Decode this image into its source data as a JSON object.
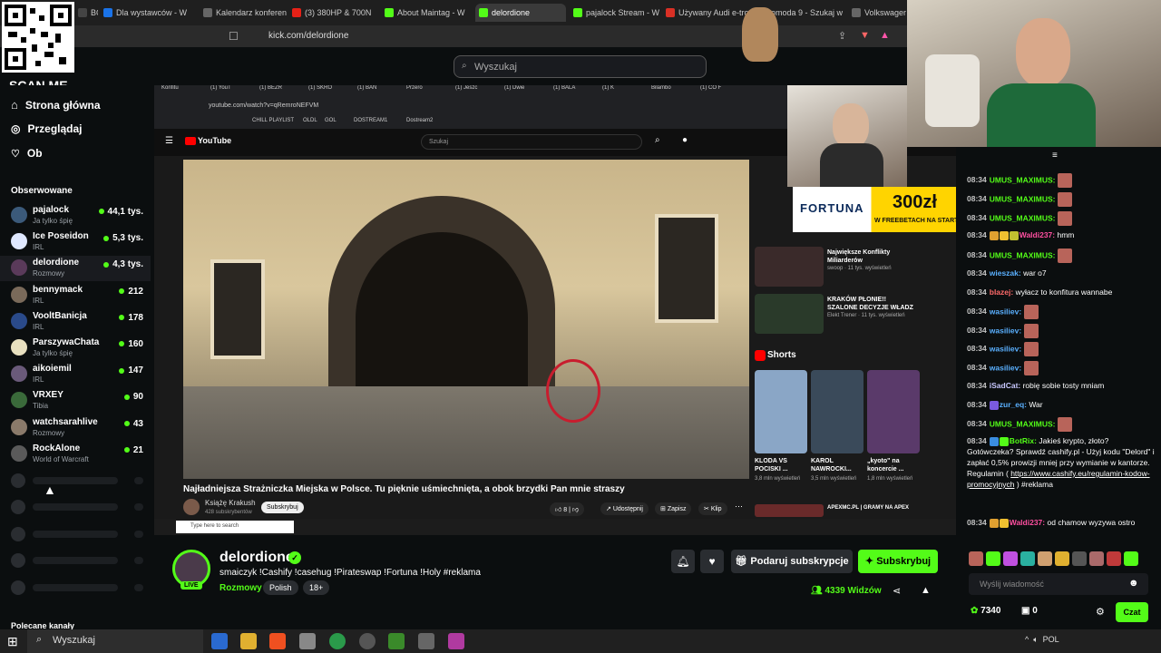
{
  "browser": {
    "tabs": [
      {
        "label": "BO"
      },
      {
        "label": "Dla wystawców - W"
      },
      {
        "label": "Kalendarz konferen"
      },
      {
        "label": "(3) 380HP & 700N"
      },
      {
        "label": "About Maintag - W"
      },
      {
        "label": "delordione"
      },
      {
        "label": "pajalock Stream - W"
      },
      {
        "label": "Używany Audi e-tro"
      },
      {
        "label": "omoda 9 - Szukaj w"
      },
      {
        "label": "Volkswager"
      }
    ],
    "url": "kick.com/delordione"
  },
  "overlay": {
    "scan_me": "SCAN ME",
    "qr_icon": "qr-code"
  },
  "header": {
    "search_placeholder": "Wyszukaj"
  },
  "sidebar": {
    "nav": [
      {
        "label": "Strona główna",
        "icon": "home-icon"
      },
      {
        "label": "Przeglądaj",
        "icon": "compass-icon"
      },
      {
        "label": "Ob",
        "icon": "heart-icon"
      }
    ],
    "following_title": "Obserwowane",
    "following": [
      {
        "name": "pajalock",
        "category": "Ja tylko śpię",
        "viewers": "44,1 tys.",
        "color": "#3b5a7a"
      },
      {
        "name": "Ice Poseidon",
        "category": "IRL",
        "viewers": "5,3 tys.",
        "color": "#dfe8ff"
      },
      {
        "name": "delordione",
        "category": "Rozmowy",
        "viewers": "4,3 tys.",
        "color": "#5a3a5a"
      },
      {
        "name": "bennymack",
        "category": "IRL",
        "viewers": "212",
        "color": "#7a6a5a"
      },
      {
        "name": "VooltBanicja",
        "category": "IRL",
        "viewers": "178",
        "color": "#2a4a8a"
      },
      {
        "name": "ParszywaChata",
        "category": "Ja tylko śpię",
        "viewers": "160",
        "color": "#e8e0c0"
      },
      {
        "name": "aikoiemil",
        "category": "IRL",
        "viewers": "147",
        "color": "#6a5a7a"
      },
      {
        "name": "VRXEY",
        "category": "Tibia",
        "viewers": "90",
        "color": "#3a6a3a"
      },
      {
        "name": "watchsarahlive",
        "category": "Rozmowy",
        "viewers": "43",
        "color": "#8a7a6a"
      },
      {
        "name": "RockAlone",
        "category": "World of Warcraft",
        "viewers": "21",
        "color": "#5a5a5a"
      }
    ],
    "recommended_title": "Polecane kanały"
  },
  "video": {
    "tabs": [
      "Konfitu",
      "(1) YouT",
      "(1) BEZR",
      "(1) SKRO",
      "(1) BAN",
      "Przero",
      "(1) Jeszc",
      "(1) Dwie",
      "(1) BALA",
      "(1) K",
      "Bilambo",
      "(1) CO F"
    ],
    "inner_url": "youtube.com/watch?v=qRemroNEFVM",
    "bookmarks": [
      "CHILL PLAYLIST",
      "OLDL",
      "GOL",
      "DOSTREAM1",
      "Dostream2"
    ],
    "yt_logo": "YouTube",
    "yt_search": "Szukaj",
    "title": "Najładniejsza Strażniczka Miejska w Polsce. Tu pięknie uśmiechnięta, a obok brzydki Pan mnie straszy",
    "channel": "Książę Krakush",
    "channel_subs": "428 subskrybentów",
    "subscribe": "Subskrybuj",
    "likes": "8",
    "share": "Udostępnij",
    "save": "Zapisz",
    "clip": "Klip",
    "sidebar_cards": [
      {
        "title": "Największe Konflikty Miliarderów",
        "meta": "swoop · 11 tys. wyświetleń",
        "color": "#3a2a2a"
      },
      {
        "title": "KRAKÓW PŁONIE!! SZALONE DECYZJE WŁADZ",
        "meta": "Elekt Trener · 11 tys. wyświetleń",
        "color": "#2a3a2a"
      }
    ],
    "shorts_label": "Shorts",
    "shorts": [
      {
        "title": "KLODA VS POCISKI ...",
        "views": "3,8 mln wyświetleń",
        "color": "#8aa6c6"
      },
      {
        "title": "KAROL NAWROCKI...",
        "views": "3,5 mln wyświetleń",
        "color": "#3a4a5a"
      },
      {
        "title": "„kyoto\" na koncercie ...",
        "views": "1,8 mln wyświetleń",
        "color": "#5a3a6a"
      }
    ],
    "extra_card": "APEXMC.PL | GRAMY NA APEX",
    "taskbar_search": "Type here to search",
    "fortuna_brand": "FORTUNA",
    "fortuna_promo": "300zł",
    "fortuna_tagline": "W FREEBETACH NA START"
  },
  "stream": {
    "name": "delordione",
    "live": "LIVE",
    "title": "smaiczyk !Cashify !casehug !Pirateswap !Fortuna !Holy #reklama",
    "category": "Rozmowy",
    "tags": [
      "Polish",
      "18+"
    ],
    "gift_subs": "Podaruj subskrypcje",
    "subscribe": "Subskrybuj",
    "viewers": "4339 Widzów"
  },
  "chat": {
    "messages": [
      {
        "time": "08:34",
        "user": "UMUS_MAXIMUS:",
        "color": "#53fc18",
        "text": "",
        "emote": true
      },
      {
        "time": "08:34",
        "user": "UMUS_MAXIMUS:",
        "color": "#53fc18",
        "text": "",
        "emote": true
      },
      {
        "time": "08:34",
        "user": "UMUS_MAXIMUS:",
        "color": "#53fc18",
        "text": "",
        "emote": true
      },
      {
        "time": "08:34",
        "user": "Waldi237:",
        "color": "#ff4fa0",
        "text": "hmm",
        "emote": false
      },
      {
        "time": "08:34",
        "user": "UMUS_MAXIMUS:",
        "color": "#53fc18",
        "text": "",
        "emote": true
      },
      {
        "time": "08:34",
        "user": "wieszak:",
        "color": "#5ab0ff",
        "text": "war o7",
        "emote": false
      },
      {
        "time": "08:34",
        "user": "blazej:",
        "color": "#ff6a6a",
        "text": "wyłacz to konfitura wannabe",
        "emote": false
      },
      {
        "time": "08:34",
        "user": "wasiliev:",
        "color": "#5ab0ff",
        "text": "",
        "emote": true
      },
      {
        "time": "08:34",
        "user": "wasiliev:",
        "color": "#5ab0ff",
        "text": "",
        "emote": true
      },
      {
        "time": "08:34",
        "user": "wasiliev:",
        "color": "#5ab0ff",
        "text": "",
        "emote": true
      },
      {
        "time": "08:34",
        "user": "wasiliev:",
        "color": "#5ab0ff",
        "text": "",
        "emote": true
      },
      {
        "time": "08:34",
        "user": "iSadCat:",
        "color": "#c8c8ff",
        "text": "robię sobie tosty mniam",
        "emote": false
      },
      {
        "time": "08:34",
        "user": "zur_eq:",
        "color": "#5ab0ff",
        "text": "War",
        "emote": false
      },
      {
        "time": "08:34",
        "user": "UMUS_MAXIMUS:",
        "color": "#53fc18",
        "text": "",
        "emote": true
      }
    ],
    "botrix": {
      "time": "08:34",
      "user": "BotRix:",
      "text": "Jakieś krypto, złoto? Gotówczeka? Sprawdź cashify.pl - Użyj kodu \"Delord\" i zapłać 0,5% prowizji mniej przy wymianie w kantorze. Regulamin (",
      "link": "https://www.cashify.eu/regulamin-kodow-promocyjnych",
      "suffix": ") #reklama"
    },
    "last": {
      "time": "08:34",
      "user": "Waldi237:",
      "text": "od chamow wyzywa ostro"
    },
    "input_placeholder": "Wyślij wiadomość",
    "points": "7340",
    "boxes": "0",
    "send": "Czat"
  },
  "taskbar": {
    "search": "Wyszukaj",
    "lang": "POL"
  }
}
